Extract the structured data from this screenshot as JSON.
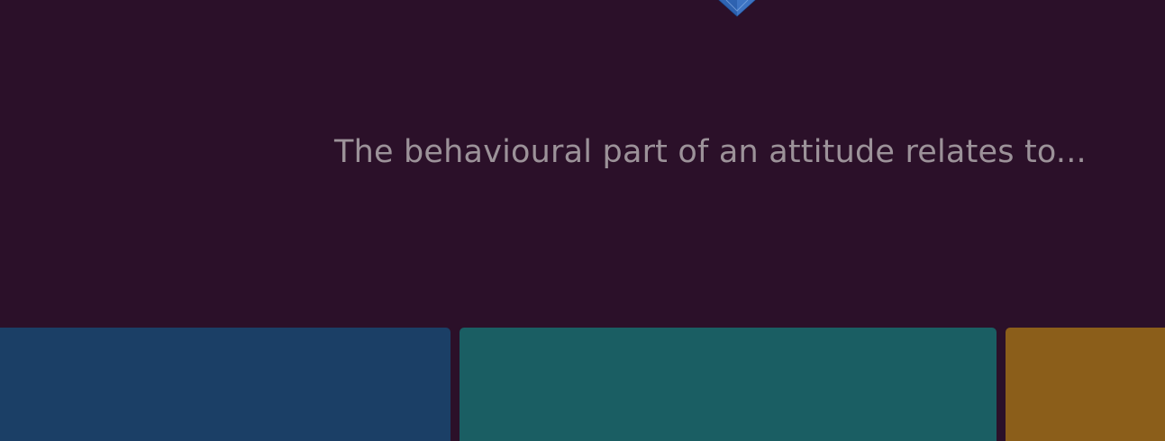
{
  "question": {
    "text": "The behavioural part of an attitude relates to..."
  },
  "decor": {
    "icon": "gem-icon"
  },
  "options": [
    {
      "color": "#1b3f66"
    },
    {
      "color": "#1a5e63"
    },
    {
      "color": "#8b5e1a"
    }
  ]
}
